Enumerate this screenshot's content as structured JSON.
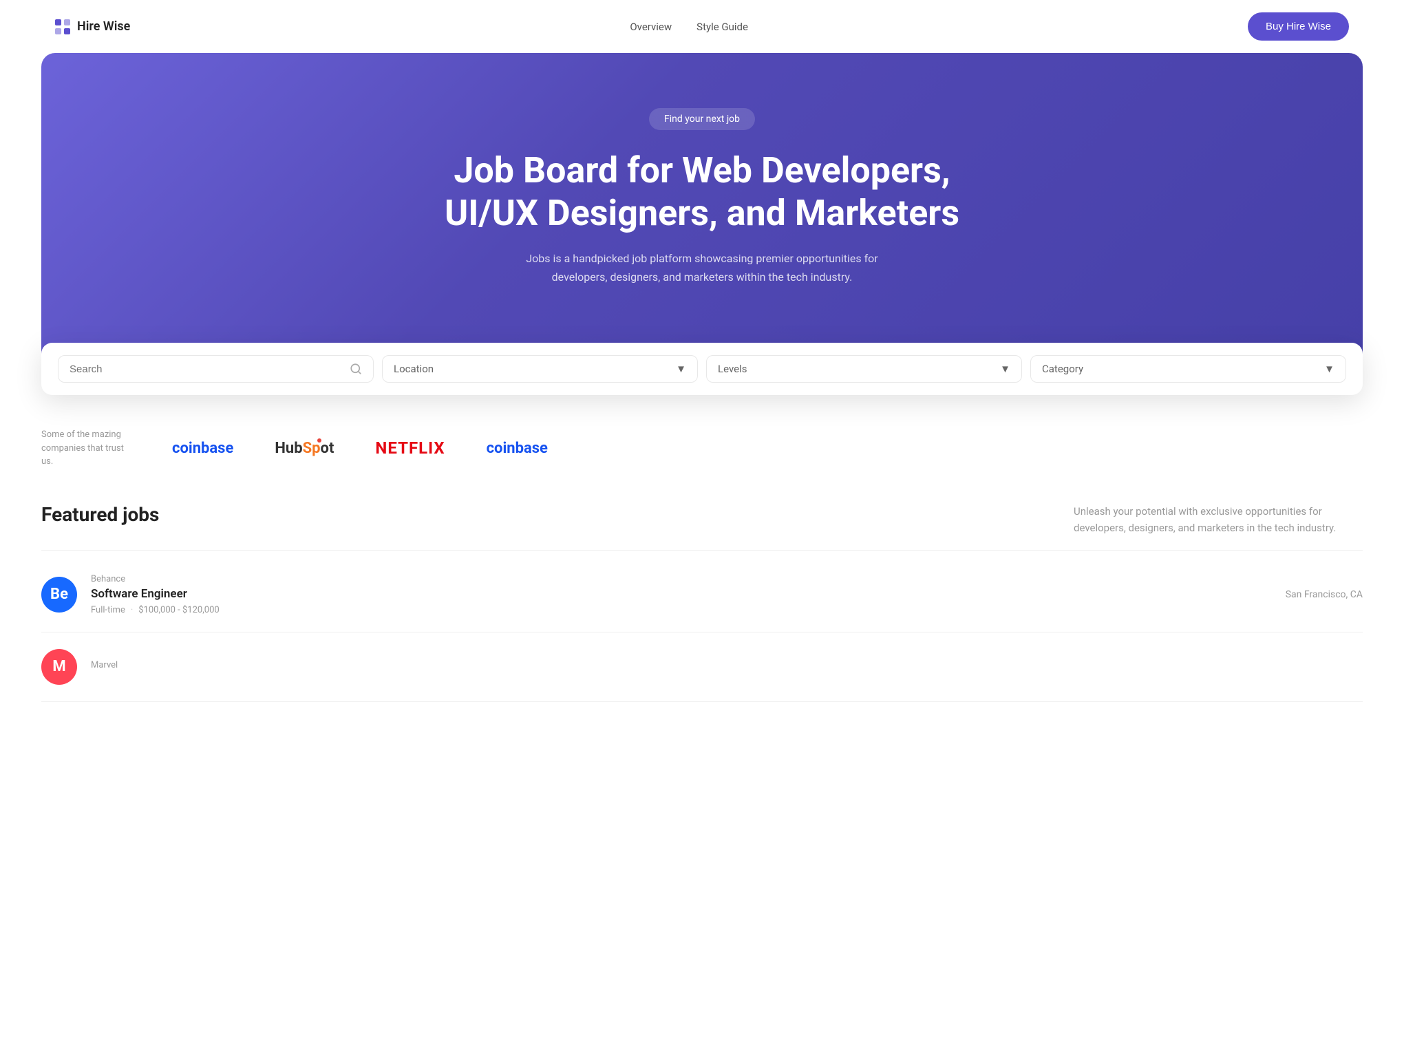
{
  "navbar": {
    "logo_text": "Hire Wise",
    "nav_items": [
      {
        "label": "Overview",
        "href": "#"
      },
      {
        "label": "Style Guide",
        "href": "#"
      }
    ],
    "cta_button": "Buy Hire Wise"
  },
  "hero": {
    "badge": "Find your next job",
    "title": "Job Board for Web Developers,\nUI/UX Designers, and Marketers",
    "description": "Jobs is a handpicked job platform showcasing premier opportunities for developers, designers, and marketers within the tech industry."
  },
  "search_bar": {
    "search_placeholder": "Search",
    "location_label": "Location",
    "levels_label": "Levels",
    "category_label": "Category"
  },
  "trusted": {
    "label": "Some of the mazing companies that trust us.",
    "companies": [
      {
        "name": "coinbase",
        "display": "coinbase",
        "style": "coinbase"
      },
      {
        "name": "hubspot",
        "display": "HubSpot",
        "style": "hubspot-brand"
      },
      {
        "name": "netflix",
        "display": "NETFLIX",
        "style": "netflix"
      },
      {
        "name": "coinbase2",
        "display": "coinbase",
        "style": "coinbase"
      }
    ]
  },
  "featured_jobs": {
    "title": "Featured jobs",
    "description": "Unleash your potential with exclusive opportunities for developers, designers, and marketers in the tech industry.",
    "jobs": [
      {
        "id": 1,
        "company": "Behance",
        "avatar_letter": "Be",
        "avatar_class": "avatar-behance",
        "title": "Software Engineer",
        "type": "Full-time",
        "salary": "$100,000 - $120,000",
        "location": "San Francisco, CA"
      },
      {
        "id": 2,
        "company": "Marvel",
        "avatar_letter": "M",
        "avatar_class": "avatar-marvel",
        "title": "",
        "type": "",
        "salary": "",
        "location": ""
      }
    ]
  }
}
